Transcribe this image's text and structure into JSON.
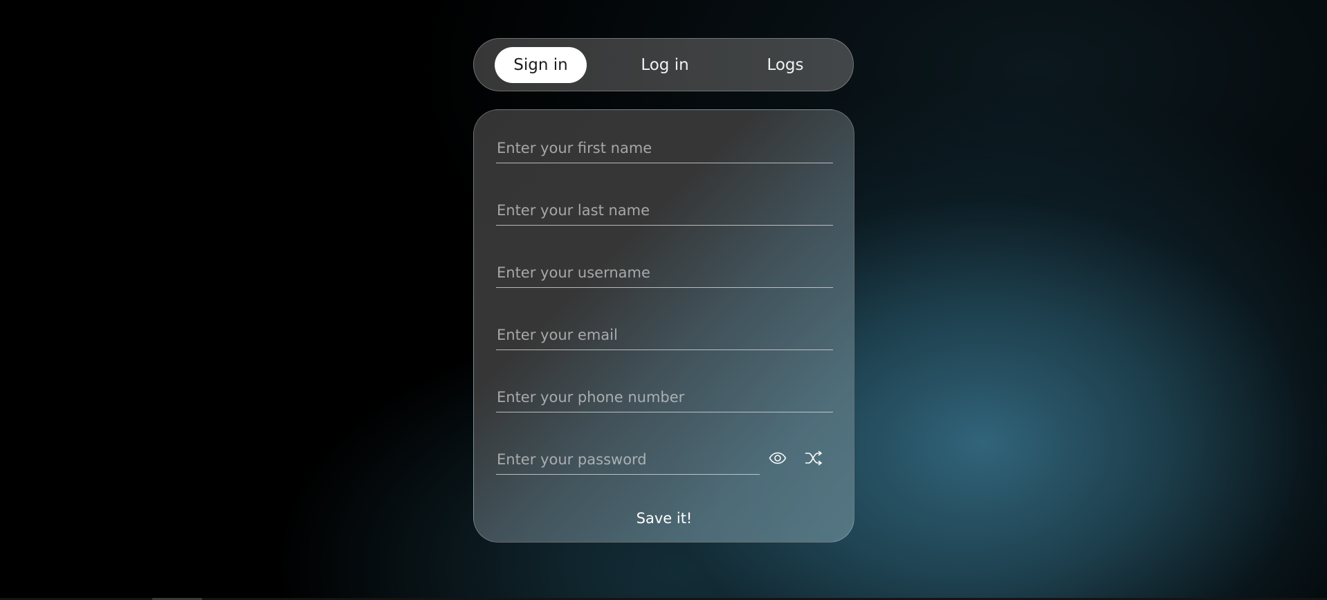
{
  "tabs": [
    {
      "label": "Sign in",
      "active": true
    },
    {
      "label": "Log in",
      "active": false
    },
    {
      "label": "Logs",
      "active": false
    }
  ],
  "form": {
    "first_name": {
      "placeholder": "Enter your first name",
      "value": ""
    },
    "last_name": {
      "placeholder": "Enter your last name",
      "value": ""
    },
    "username": {
      "placeholder": "Enter your username",
      "value": ""
    },
    "email": {
      "placeholder": "Enter your email",
      "value": ""
    },
    "phone": {
      "placeholder": "Enter your phone number",
      "value": ""
    },
    "password": {
      "placeholder": "Enter your password",
      "value": ""
    },
    "icons": {
      "show_password": "eye-icon",
      "generate_password": "shuffle-icon"
    },
    "submit_label": "Save it!"
  },
  "colors": {
    "active_tab_bg": "#ffffff",
    "active_tab_text": "#1c1c1c",
    "text": "#ffffff",
    "accent_glow": "#346980"
  }
}
